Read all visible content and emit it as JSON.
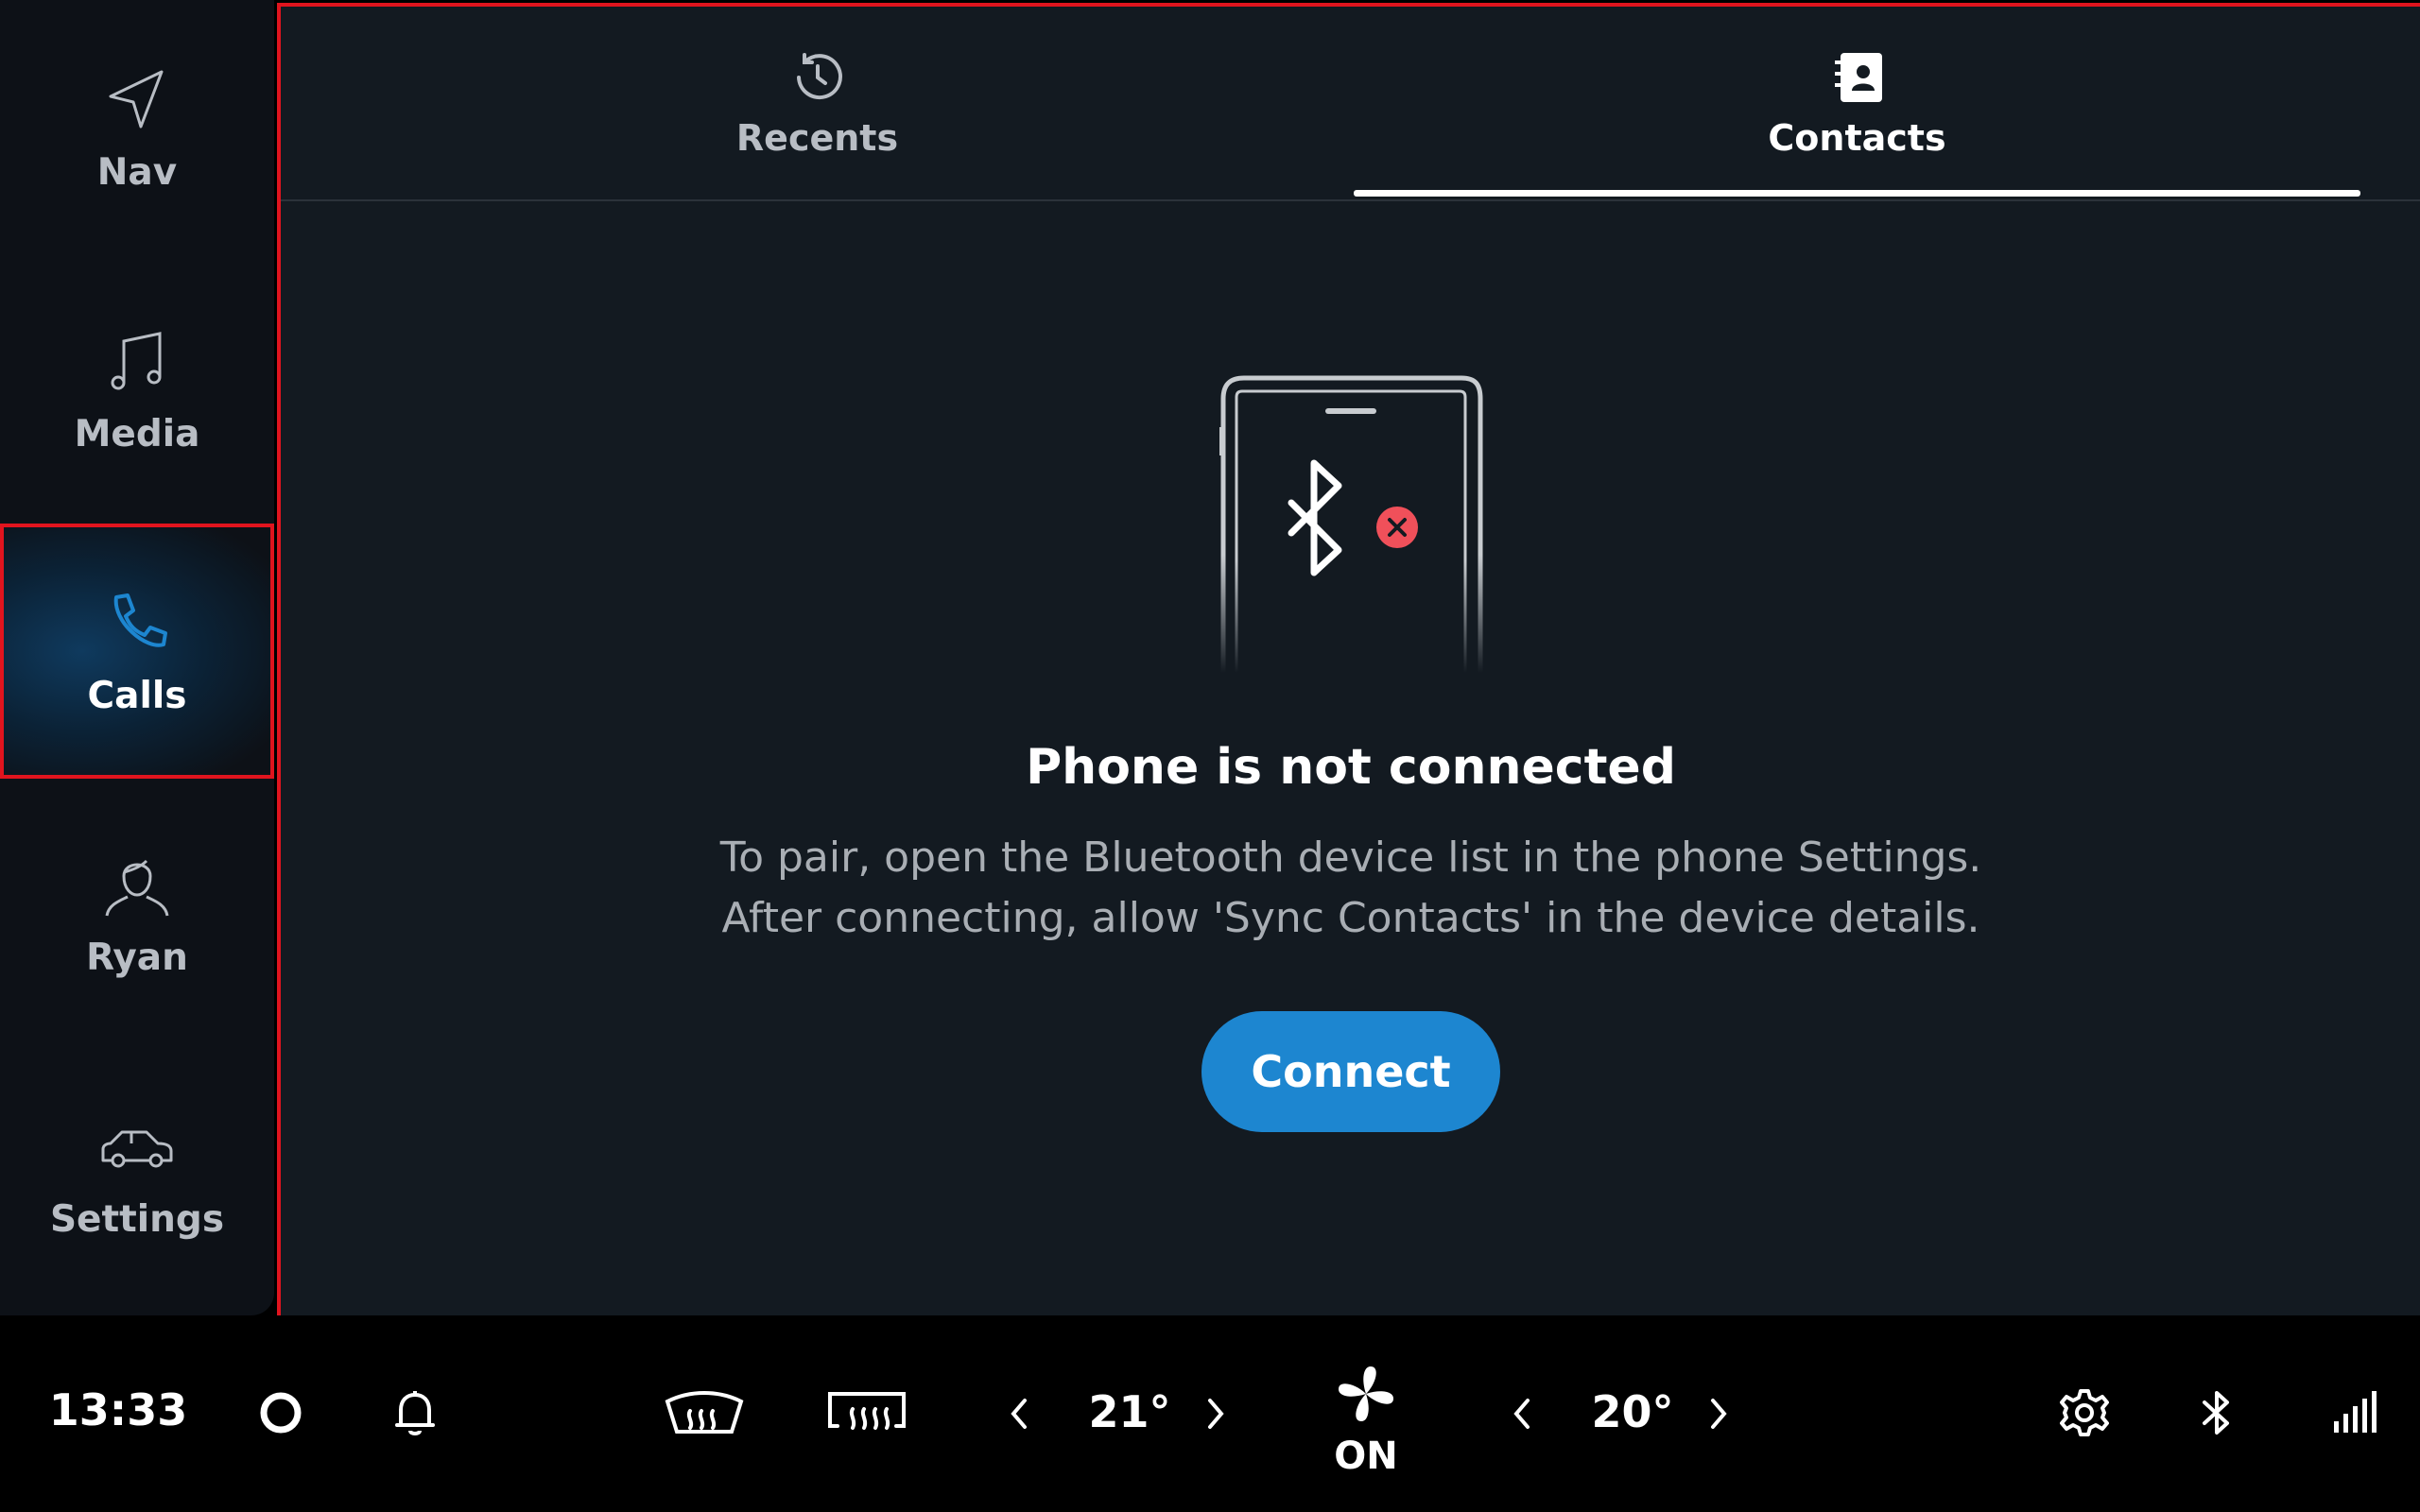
{
  "sidebar": {
    "items": [
      {
        "label": "Nav",
        "icon": "navigation-arrow-icon"
      },
      {
        "label": "Media",
        "icon": "music-note-icon"
      },
      {
        "label": "Calls",
        "icon": "phone-icon",
        "active": true
      },
      {
        "label": "Ryan",
        "icon": "user-profile-icon"
      },
      {
        "label": "Settings",
        "icon": "car-icon"
      }
    ]
  },
  "tabs": [
    {
      "label": "Recents",
      "icon": "history-icon"
    },
    {
      "label": "Contacts",
      "icon": "contacts-book-icon",
      "selected": true
    }
  ],
  "empty_state": {
    "title": "Phone is not connected",
    "line1": "To pair, open the Bluetooth device list in the phone Settings.",
    "line2": "After connecting, allow 'Sync Contacts' in the device details.",
    "button": "Connect"
  },
  "bottom_bar": {
    "time": "13:33",
    "driver_temp": "21°",
    "passenger_temp": "20°",
    "fan_status": "ON"
  },
  "colors": {
    "accent": "#1d86d0",
    "error": "#f0505a",
    "highlight": "#e0141e"
  }
}
